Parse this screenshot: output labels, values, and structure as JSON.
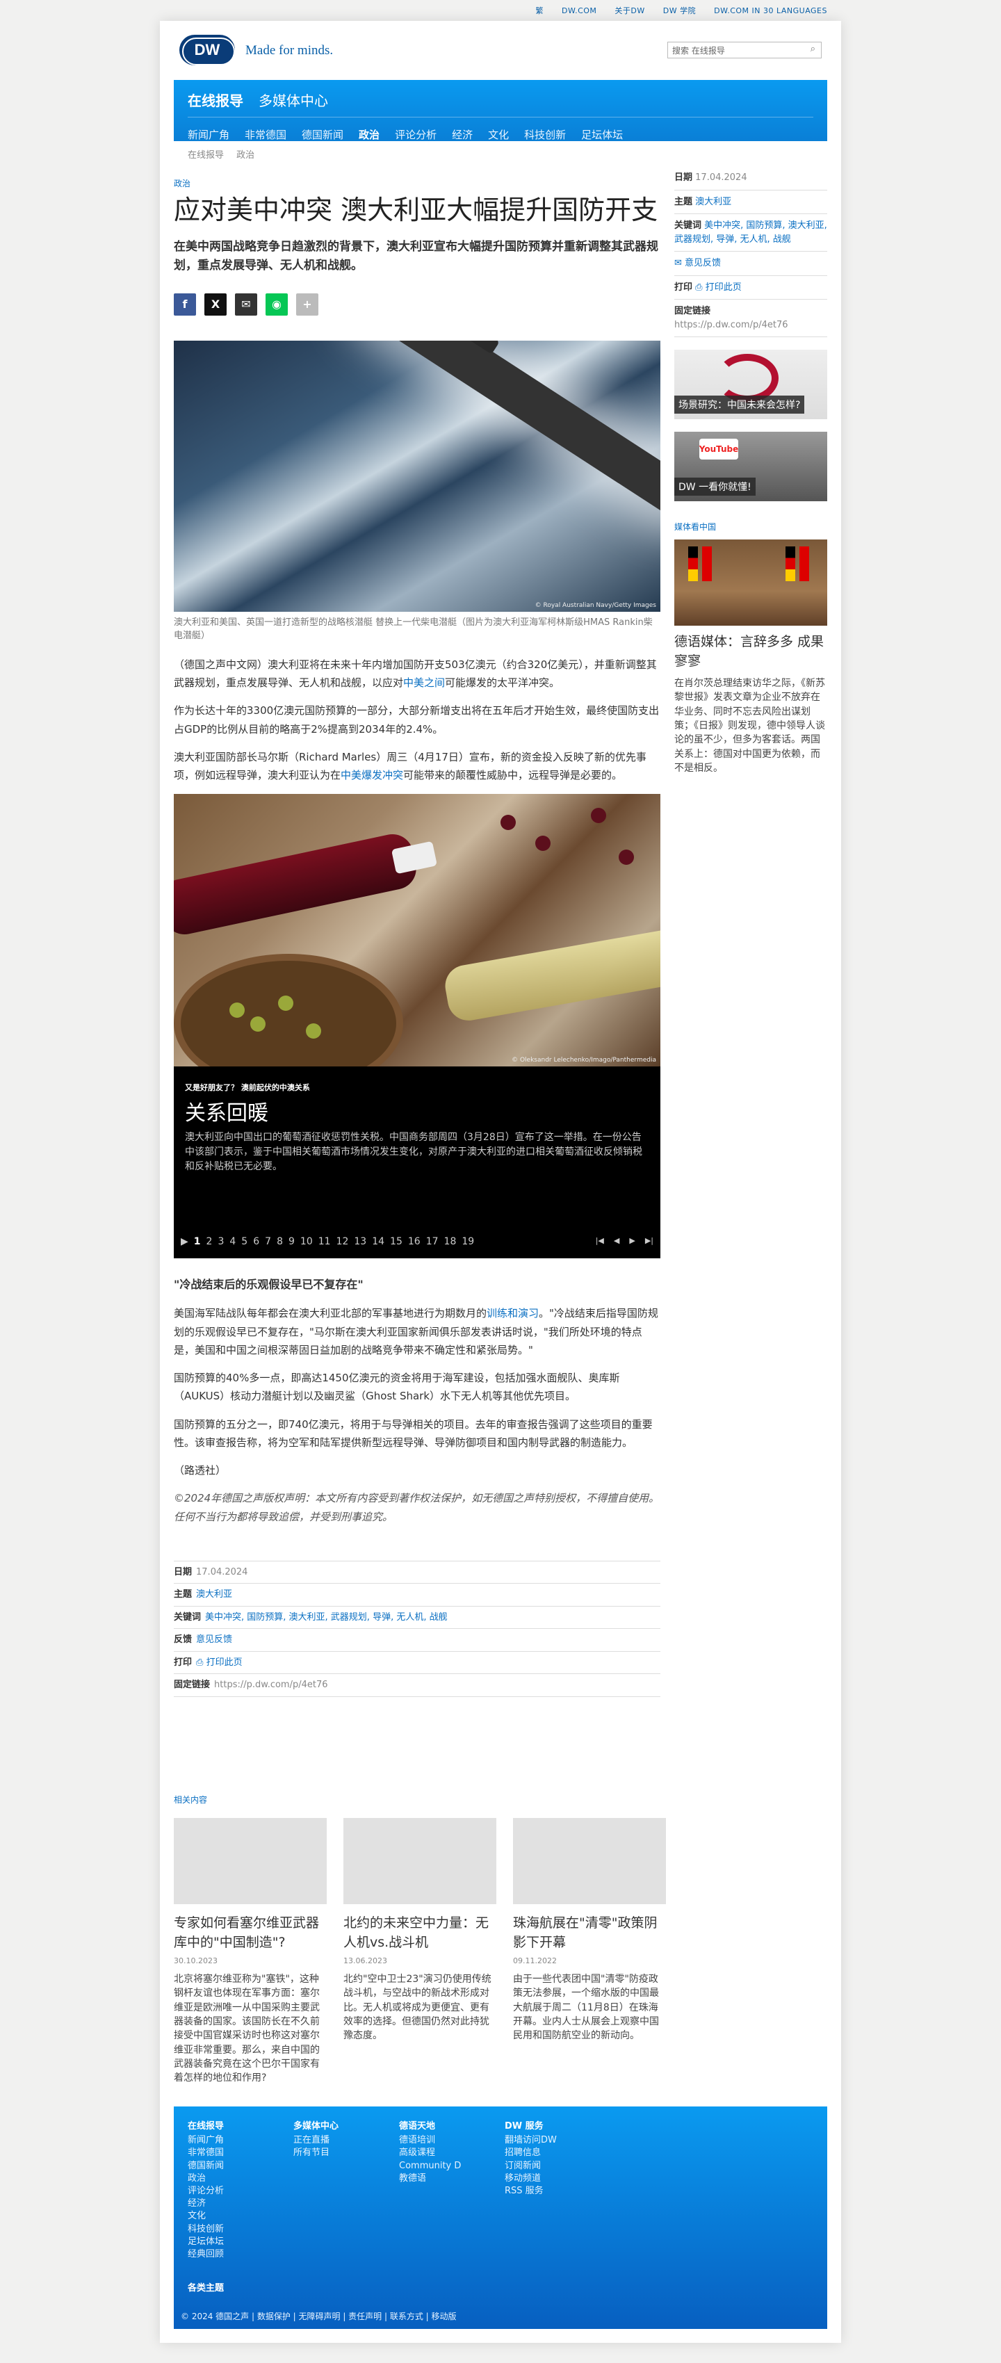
{
  "topbar": {
    "items": [
      "繁",
      "DW.COM",
      "关于DW",
      "DW 学院",
      "DW.COM IN 30 LANGUAGES"
    ]
  },
  "header": {
    "logo": "DW",
    "tagline": "Made for minds.",
    "search_placeholder": "搜索 在线报导"
  },
  "nav": {
    "primary": [
      "在线报导",
      "多媒体中心"
    ],
    "secondary": [
      "新闻广角",
      "非常德国",
      "德国新闻",
      "政治",
      "评论分析",
      "经济",
      "文化",
      "科技创新",
      "足坛体坛"
    ],
    "active": "政治"
  },
  "breadcrumb": [
    "在线报导",
    "政治"
  ],
  "article": {
    "kicker": "政治",
    "title": "应对美中冲突 澳大利亚大幅提升国防开支",
    "lead": "在美中两国战略竞争日趋激烈的背景下，澳大利亚宣布大幅提升国防预算并重新调整其武器规划，重点发展导弹、无人机和战舰。",
    "hero_credit": "© Royal Australian Navy/Getty Images",
    "hero_caption": "澳大利亚和美国、英国一道打造新型的战略核潜艇 替换上一代柴电潜艇（图片为澳大利亚海军柯林斯级HMAS Rankin柴电潜艇）",
    "p1a": "（德国之声中文网）澳大利亚将在未来十年内增加国防开支503亿澳元（约合320亿美元），并重新调整其武器规划，重点发展导弹、无人机和战舰，以应对",
    "p1link": "中美之间",
    "p1b": "可能爆发的太平洋冲突。",
    "p2": "作为长达十年的3300亿澳元国防预算的一部分，大部分新增支出将在五年后才开始生效，最终使国防支出占GDP的比例从目前的略高于2%提高到2034年的2.4%。",
    "p3a": "澳大利亚国防部长马尔斯（Richard Marles）周三（4月17日）宣布，新的资金投入反映了新的优先事项，例如远程导弹，澳大利亚认为在",
    "p3link": "中美爆发冲突",
    "p3b": "可能带来的颠覆性威胁中，远程导弹是必要的。",
    "gallery": {
      "credit": "© Oleksandr Lelechenko/Imago/Panthermedia",
      "kicker": "又是好朋友了？ 澳前起伏的中澳关系",
      "title": "关系回暖",
      "desc": "澳大利亚向中国出口的葡萄酒征收惩罚性关税。中国商务部周四（3月28日）宣布了这一举措。在一份公告中该部门表示，鉴于中国相关葡萄酒市场情况发生变化，对原产于澳大利亚的进口相关葡萄酒征收反倾销税和反补贴税已无必要。",
      "pages": [
        "1",
        "2",
        "3",
        "4",
        "5",
        "6",
        "7",
        "8",
        "9",
        "10",
        "11",
        "12",
        "13",
        "14",
        "15",
        "16",
        "17",
        "18",
        "19"
      ],
      "current": "1"
    },
    "h3": "\"冷战结束后的乐观假设早已不复存在\"",
    "p4a": "美国海军陆战队每年都会在澳大利亚北部的军事基地进行为期数月的",
    "p4link": "训练和演习",
    "p4b": "。\"冷战结束后指导国防规划的乐观假设早已不复存在，\"马尔斯在澳大利亚国家新闻俱乐部发表讲话时说，\"我们所处环境的特点是，美国和中国之间根深蒂固日益加剧的战略竞争带来不确定性和紧张局势。\"",
    "p5": "国防预算的40%多一点，即高达1450亿澳元的资金将用于海军建设，包括加强水面舰队、奥库斯（AUKUS）核动力潜艇计划以及幽灵鲨（Ghost Shark）水下无人机等其他优先项目。",
    "p6": "国防预算的五分之一，即740亿澳元，将用于与导弹相关的项目。去年的审查报告强调了这些项目的重要性。该审查报告称，将为空军和陆军提供新型远程导弹、导弹防御项目和国内制导武器的制造能力。",
    "p7": "（路透社）",
    "copyright": "©2024年德国之声版权声明：本文所有内容受到著作权法保护，如无德国之声特别授权，不得擅自使用。任何不当行为都将导致追偿，并受到刑事追究。"
  },
  "meta": {
    "date_label": "日期",
    "date": "17.04.2024",
    "topic_label": "主题",
    "topic": "澳大利亚",
    "kw_label": "关键词",
    "keywords": "美中冲突, 国防预算, 澳大利亚, 武器规划, 导弹, 无人机, 战舰",
    "fb_label": "反馈",
    "fb": "意见反馈",
    "print_label": "打印",
    "print": "打印此页",
    "link_label": "固定链接",
    "link": "https://p.dw.com/p/4et76"
  },
  "sidebar": {
    "promo1": "场景研究：中国未来会怎样?",
    "promo2": "DW 一看你就懂!",
    "yt": "YouTube",
    "media_head": "媒体看中国",
    "media_title": "德语媒体：言辞多多 成果寥寥",
    "media_desc": "在肖尔茨总理结束访华之际，《新苏黎世报》发表文章为企业不放弃在华业务、同时不忘去风险出谋划策；《日报》则发现，德中领导人谈论的虽不少，但多为客套话。两国关系上：德国对中国更为依赖，而不是相反。"
  },
  "related": {
    "head": "相关内容",
    "items": [
      {
        "title": "专家如何看塞尔维亚武器库中的\"中国制造\"?",
        "date": "30.10.2023",
        "desc": "北京将塞尔维亚称为\"塞铁\"，这种钢杆友谊也体现在军事方面：塞尔维亚是欧洲唯一从中国采购主要武器装备的国家。该国防长在不久前接受中国官媒采访时也称这对塞尔维亚非常重要。那么，来自中国的武器装备究竟在这个巴尔干国家有着怎样的地位和作用?"
      },
      {
        "title": "北约的未来空中力量：无人机vs.战斗机",
        "date": "13.06.2023",
        "desc": "北约\"空中卫士23\"演习仍使用传统战斗机，与空战中的新战术形成对比。无人机或将成为更便宜、更有效率的选择。但德国仍然对此持犹豫态度。"
      },
      {
        "title": "珠海航展在\"清零\"政策阴影下开幕",
        "date": "09.11.2022",
        "desc": "由于一些代表团中国\"清零\"防疫政策无法参展，一个缩水版的中国最大航展于周二（11月8日）在珠海开幕。业内人士从展会上观察中国民用和国防航空业的新动向。"
      }
    ]
  },
  "footer": {
    "cols": [
      {
        "head": "在线报导",
        "items": [
          "新闻广角",
          "非常德国",
          "德国新闻",
          "政治",
          "评论分析",
          "经济",
          "文化",
          "科技创新",
          "足坛体坛",
          "经典回顾"
        ]
      },
      {
        "head": "多媒体中心",
        "items": [
          "正在直播",
          "所有节目"
        ]
      },
      {
        "head": "德语天地",
        "items": [
          "德语培训",
          "高级课程",
          "Community D",
          "教德语"
        ]
      },
      {
        "head": "DW 服务",
        "items": [
          "翻墙访问DW",
          "招聘信息",
          "订阅新闻",
          "移动频道",
          "RSS 服务"
        ]
      }
    ],
    "more": "各类主题",
    "copy": "© 2024 德国之声 | 数据保护 | 无障碍声明 | 责任声明 | 联系方式 | 移动版"
  },
  "colors": {
    "accent": "#0a9af0",
    "link": "#0a6fc2"
  }
}
